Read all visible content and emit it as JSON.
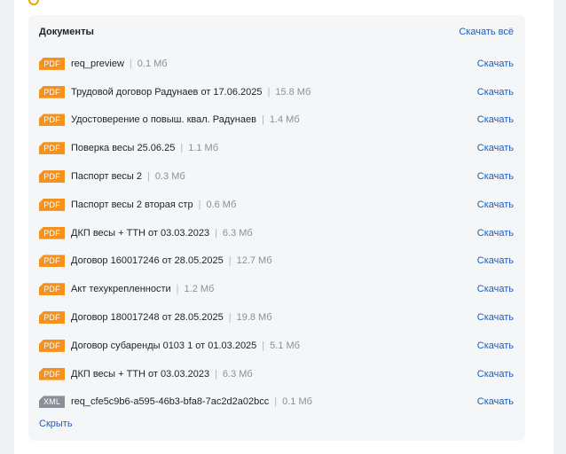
{
  "documents": {
    "title": "Документы",
    "download_all_label": "Скачать всё",
    "hide_label": "Скрыть",
    "download_label": "Скачать",
    "separator": "|",
    "items": [
      {
        "type": "PDF",
        "name": "req_preview",
        "size": "0.1 Мб"
      },
      {
        "type": "PDF",
        "name": "Трудовой договор Радунаев от 17.06.2025",
        "size": "15.8 Мб"
      },
      {
        "type": "PDF",
        "name": "Удостоверение о повыш. квал. Радунаев",
        "size": "1.4 Мб"
      },
      {
        "type": "PDF",
        "name": "Поверка весы 25.06.25",
        "size": "1.1 Мб"
      },
      {
        "type": "PDF",
        "name": "Паспорт весы 2",
        "size": "0.3 Мб"
      },
      {
        "type": "PDF",
        "name": "Паспорт весы 2 вторая стр",
        "size": "0.6 Мб"
      },
      {
        "type": "PDF",
        "name": "ДКП весы + ТТН от 03.03.2023",
        "size": "6.3 Мб"
      },
      {
        "type": "PDF",
        "name": "Договор 160017246 от 28.05.2025",
        "size": "12.7 Мб"
      },
      {
        "type": "PDF",
        "name": "Акт техукрепленности",
        "size": "1.2 Мб"
      },
      {
        "type": "PDF",
        "name": "Договор 180017248 от 28.05.2025",
        "size": "19.8 Мб"
      },
      {
        "type": "PDF",
        "name": "Договор субаренды 0103 1 от 01.03.2025",
        "size": "5.1 Мб"
      },
      {
        "type": "PDF",
        "name": "ДКП весы + ТТН от 03.03.2023",
        "size": "6.3 Мб"
      },
      {
        "type": "XML",
        "name": "req_cfe5c9b6-a595-46b3-bfa8-7ac2d2a02bcc",
        "size": "0.1 Мб"
      }
    ]
  }
}
